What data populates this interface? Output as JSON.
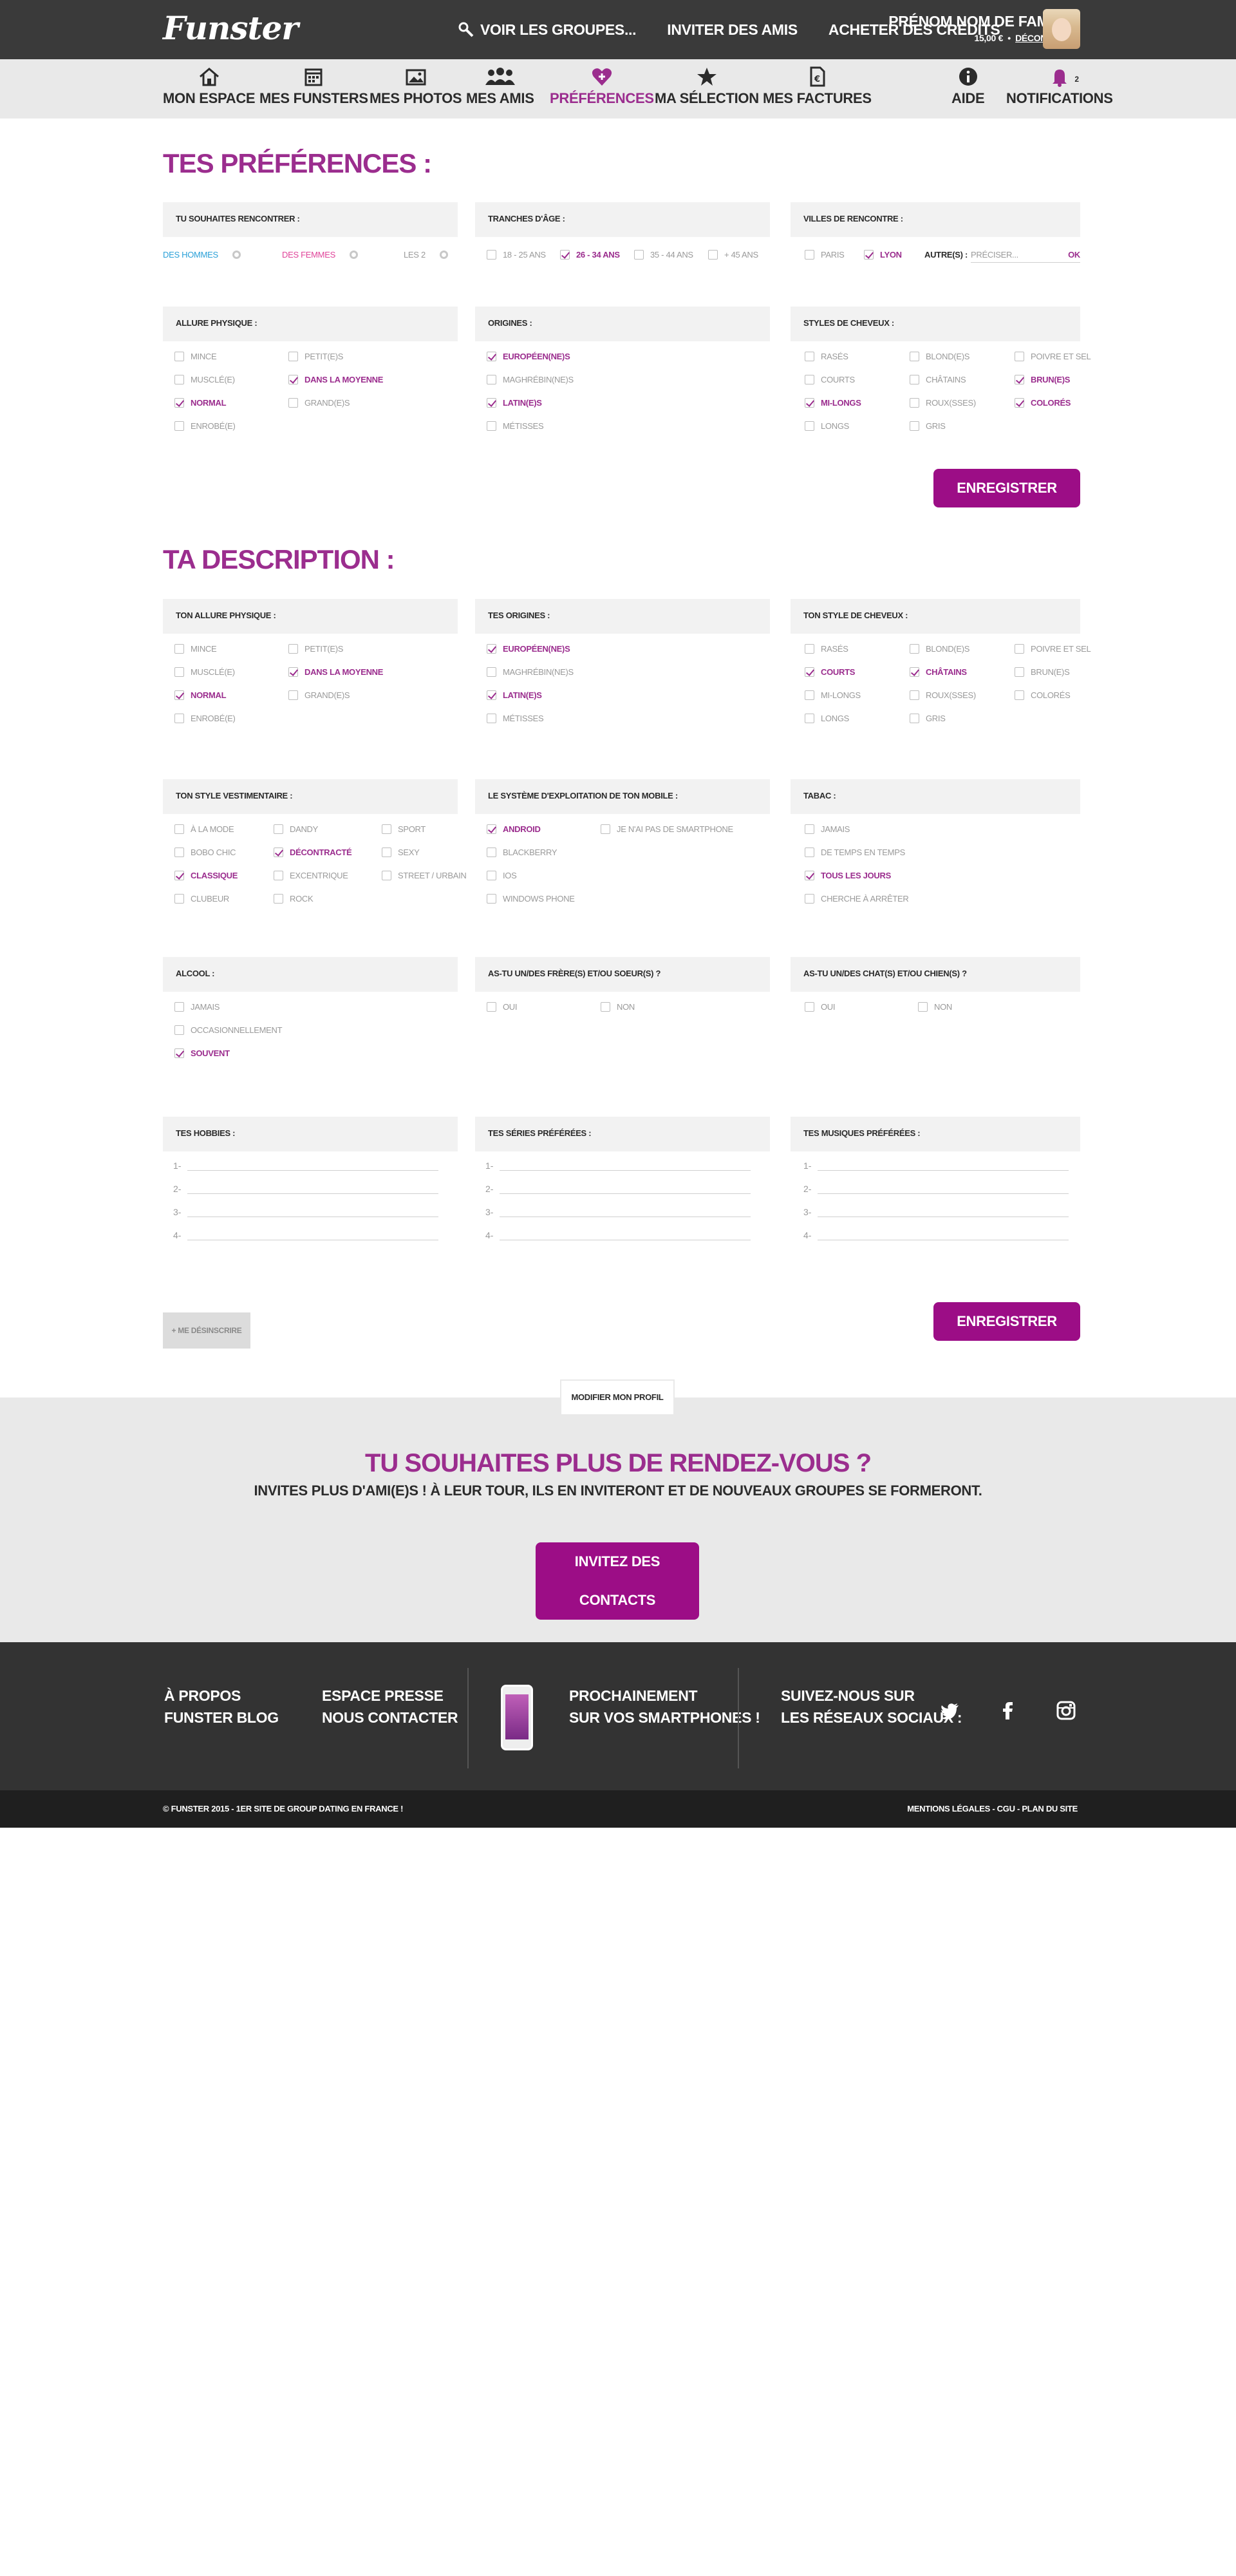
{
  "header": {
    "logo": "Funster",
    "links": [
      "Voir les groupes...",
      "Inviter des amis",
      "Acheter des crédits"
    ],
    "user_name": "Prénom Nom de famille",
    "credits": "15,00 €",
    "separator": "•",
    "logout": "Déconnexion"
  },
  "nav": {
    "items": [
      {
        "label": "Mon espace",
        "icon": "home-icon"
      },
      {
        "label": "Mes Funsters",
        "icon": "calendar-icon"
      },
      {
        "label": "Mes photos",
        "icon": "photo-icon"
      },
      {
        "label": "Mes amis",
        "icon": "friends-icon"
      },
      {
        "label": "Préférences",
        "icon": "heart-plus-icon"
      },
      {
        "label": "Ma sélection",
        "icon": "star-icon"
      },
      {
        "label": "Mes factures",
        "icon": "invoice-icon"
      },
      {
        "label": "Aide",
        "icon": "info-icon"
      },
      {
        "label": "Notifications",
        "icon": "bell-icon",
        "badge": "2"
      }
    ]
  },
  "prefs": {
    "title": "Tes préférences :",
    "meet": {
      "header": "Tu souhaites rencontrer :",
      "options": [
        "Des hommes",
        "Des femmes",
        "Les 2"
      ]
    },
    "ages": {
      "header": "Tranches d'âge :",
      "options": [
        "18 - 25 ans",
        "26 - 34 ans",
        "35 - 44 ans",
        "+ 45 ans"
      ]
    },
    "cities": {
      "header": "Villes de rencontre :",
      "options": [
        "Paris",
        "Lyon"
      ],
      "other_label": "Autre(s) :",
      "other_placeholder": "Préciser...",
      "ok": "OK"
    },
    "allure": {
      "header": "Allure physique :",
      "options": [
        "Mince",
        "Petit(e)s",
        "Musclé(e)",
        "Dans la moyenne",
        "Normal",
        "Grand(e)s",
        "Enrobé(e)"
      ]
    },
    "origins": {
      "header": "Origines :",
      "options": [
        "Européen(ne)s",
        "Maghrébin(ne)s",
        "Latin(e)s",
        "Métisses"
      ]
    },
    "hair": {
      "header": "Styles de cheveux :",
      "options": [
        "Rasés",
        "Blond(e)s",
        "Poivre et sel",
        "Courts",
        "Châtains",
        "Brun(e)s",
        "Mi-longs",
        "Roux(sses)",
        "Colorés",
        "Longs",
        "Gris"
      ]
    },
    "save": "Enregistrer"
  },
  "desc": {
    "title": "Ta description :",
    "allure": {
      "header": "Ton allure physique :",
      "options": [
        "Mince",
        "Petit(e)s",
        "Musclé(e)",
        "Dans la moyenne",
        "Normal",
        "Grand(e)s",
        "Enrobé(e)"
      ]
    },
    "origins": {
      "header": "Tes origines :",
      "options": [
        "Européen(ne)s",
        "Maghrébin(ne)s",
        "Latin(e)s",
        "Métisses"
      ]
    },
    "hair": {
      "header": "Ton style de cheveux :",
      "options": [
        "Rasés",
        "Blond(e)s",
        "Poivre et sel",
        "Courts",
        "Châtains",
        "Brun(e)s",
        "Mi-longs",
        "Roux(sses)",
        "Colorés",
        "Longs",
        "Gris"
      ]
    },
    "dress": {
      "header": "Ton style vestimentaire :",
      "options": [
        "À la mode",
        "Dandy",
        "Sport",
        "Bobo chic",
        "Décontracté",
        "Sexy",
        "Classique",
        "Excentrique",
        "Street / Urbain",
        "Clubeur",
        "Rock"
      ]
    },
    "os": {
      "header": "Le système d'exploitation de ton mobile :",
      "options": [
        "Android",
        "Je n'ai pas de smartphone",
        "Blackberry",
        "iOS",
        "Windows Phone"
      ]
    },
    "tobacco": {
      "header": "Tabac :",
      "options": [
        "Jamais",
        "De temps en temps",
        "Tous les jours",
        "Cherche à arrêter"
      ]
    },
    "alcohol": {
      "header": "Alcool :",
      "options": [
        "Jamais",
        "Occasionnellement",
        "Souvent"
      ]
    },
    "siblings": {
      "header": "As-tu un/des frère(s) et/ou soeur(s) ?",
      "options": [
        "Oui",
        "Non"
      ]
    },
    "pets": {
      "header": "As-tu un/des chat(s) et/ou chien(s) ?",
      "options": [
        "Oui",
        "Non"
      ]
    },
    "hobbies": {
      "header": "Tes hobbies :",
      "nums": [
        "1-",
        "2-",
        "3-",
        "4-"
      ]
    },
    "series": {
      "header": "Tes séries préférées :",
      "nums": [
        "1-",
        "2-",
        "3-",
        "4-"
      ]
    },
    "music": {
      "header": "Tes musiques préférées :",
      "nums": [
        "1-",
        "2-",
        "3-",
        "4-"
      ]
    },
    "save": "Enregistrer",
    "unsubscribe": "+ Me désinscrire"
  },
  "invite": {
    "tab": "Modifier mon profil",
    "title": "Tu souhaites plus de rendez-vous ?",
    "text": "Invites plus d'ami(e)s ! À leur tour, ils en inviteront et de nouveaux groupes se formeront.",
    "button": "Invitez des contacts"
  },
  "footer": {
    "col1": [
      "À propos",
      "Funster Blog"
    ],
    "col2": [
      "Espace presse",
      "Nous contacter"
    ],
    "app": [
      "Prochainement",
      "sur vos smartphones !"
    ],
    "social": [
      "Suivez-nous sur",
      "les réseaux sociaux :"
    ],
    "social_icons": [
      "twitter-icon",
      "facebook-icon",
      "instagram-icon"
    ],
    "copyright": "© Funster 2015 - 1er site de group dating en France !",
    "legal": "Mentions légales - CGU - Plan du site"
  },
  "colors": {
    "accent": "#9b2d8e",
    "button": "#9c0d86",
    "blue": "#2aa0d8",
    "pink": "#e0449a"
  }
}
